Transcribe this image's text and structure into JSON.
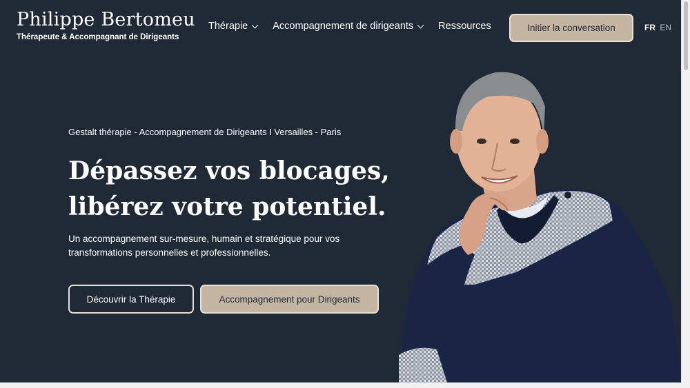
{
  "header": {
    "brand_name": "Philippe Bertomeu",
    "brand_tagline": "Thérapeute & Accompagnant de Dirigeants",
    "nav": [
      {
        "label": "Thérapie",
        "has_dropdown": true
      },
      {
        "label": "Accompagnement de dirigeants",
        "has_dropdown": true
      },
      {
        "label": "Ressources",
        "has_dropdown": false
      }
    ],
    "cta_label": "Initier la conversation",
    "lang_fr": "FR",
    "lang_en": "EN"
  },
  "hero": {
    "kicker": "Gestalt thérapie - Accompagnement de Dirigeants I Versailles - Paris",
    "headline_line1": "Dépassez vos blocages,",
    "headline_line2": "libérez votre potentiel.",
    "lead": "Un accompagnement sur-mesure, humain et stratégique pour vos transformations personnelles et professionnelles.",
    "btn_therapy": "Découvrir la Thérapie",
    "btn_leaders": "Accompagnement pour Dirigeants"
  },
  "colors": {
    "background": "#1f2a36",
    "accent": "#c4b5a2",
    "text": "#ffffff"
  }
}
